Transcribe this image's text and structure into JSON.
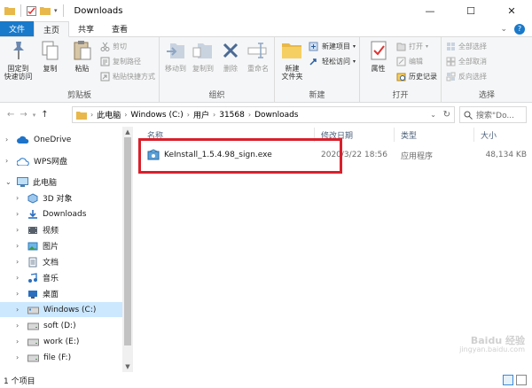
{
  "window": {
    "title": "Downloads",
    "controls": [
      "—",
      "☐",
      "✕"
    ]
  },
  "tabs": {
    "file": "文件",
    "home": "主页",
    "share": "共享",
    "view": "查看"
  },
  "ribbon": {
    "clipboard": {
      "label": "剪贴板",
      "pin": "固定到\n快速访问",
      "copy": "复制",
      "paste": "粘贴",
      "cut": "剪切",
      "copy_path": "复制路径",
      "paste_shortcut": "粘贴快捷方式"
    },
    "organize": {
      "label": "组织",
      "move_to": "移动到",
      "copy_to": "复制到",
      "delete": "删除",
      "rename": "重命名"
    },
    "new": {
      "label": "新建",
      "new_folder": "新建\n文件夹",
      "new_item": "新建项目",
      "easy_access": "轻松访问"
    },
    "open": {
      "label": "打开",
      "properties": "属性",
      "open": "打开",
      "edit": "编辑",
      "history": "历史记录"
    },
    "select": {
      "label": "选择",
      "select_all": "全部选择",
      "select_none": "全部取消",
      "invert": "反向选择"
    }
  },
  "address": {
    "crumbs": [
      "此电脑",
      "Windows (C:)",
      "用户",
      "31568",
      "Downloads"
    ],
    "search_placeholder": "搜索\"Do..."
  },
  "sidebar": {
    "onedrive": "OneDrive",
    "wps": "WPS网盘",
    "this_pc": "此电脑",
    "items": [
      "3D 对象",
      "Downloads",
      "视频",
      "图片",
      "文档",
      "音乐",
      "桌面",
      "Windows (C:)",
      "soft (D:)",
      "work (E:)",
      "file (F:)"
    ]
  },
  "columns": {
    "name": "名称",
    "modified": "修改日期",
    "type": "类型",
    "size": "大小"
  },
  "files": [
    {
      "name": "KeInstall_1.5.4.98_sign.exe",
      "modified": "2020/3/22 18:56",
      "type": "应用程序",
      "size": "48,134 KB"
    }
  ],
  "status": {
    "count": "1 个项目"
  },
  "watermark": {
    "line1": "Baidu 经验",
    "line2": "jingyan.baidu.com"
  },
  "colors": {
    "accent": "#1979ca",
    "highlight_box": "#d9202b",
    "selected": "#cce8ff"
  }
}
